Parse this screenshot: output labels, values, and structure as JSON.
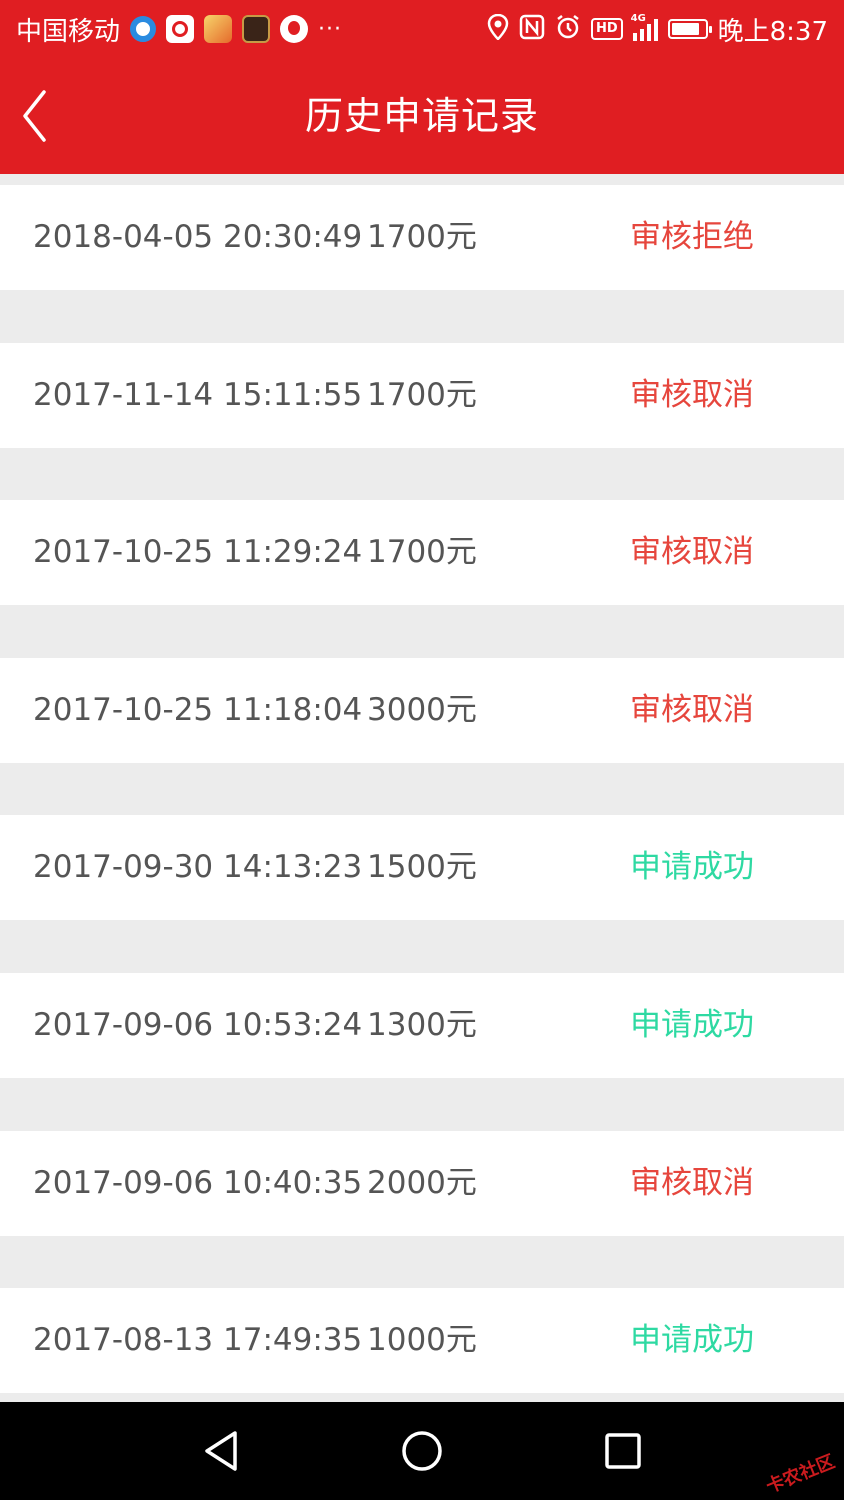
{
  "status_bar": {
    "carrier": "中国移动",
    "more": "···",
    "network": "4G",
    "time": "晚上8:37",
    "icons": [
      "location-icon",
      "nfc-icon",
      "alarm-icon",
      "hd-icon",
      "signal-icon",
      "battery-icon"
    ],
    "battery_level": 0.85
  },
  "header": {
    "title": "历史申请记录",
    "back_icon": "chevron-left-icon"
  },
  "records": [
    {
      "datetime": "2018-04-05 20:30:49",
      "amount": "1700元",
      "status": "审核拒绝",
      "status_type": "rejected"
    },
    {
      "datetime": "2017-11-14 15:11:55",
      "amount": "1700元",
      "status": "审核取消",
      "status_type": "cancelled"
    },
    {
      "datetime": "2017-10-25 11:29:24",
      "amount": "1700元",
      "status": "审核取消",
      "status_type": "cancelled"
    },
    {
      "datetime": "2017-10-25 11:18:04",
      "amount": "3000元",
      "status": "审核取消",
      "status_type": "cancelled"
    },
    {
      "datetime": "2017-09-30 14:13:23",
      "amount": "1500元",
      "status": "申请成功",
      "status_type": "success"
    },
    {
      "datetime": "2017-09-06 10:53:24",
      "amount": "1300元",
      "status": "申请成功",
      "status_type": "success"
    },
    {
      "datetime": "2017-09-06 10:40:35",
      "amount": "2000元",
      "status": "审核取消",
      "status_type": "cancelled"
    },
    {
      "datetime": "2017-08-13 17:49:35",
      "amount": "1000元",
      "status": "申请成功",
      "status_type": "success"
    }
  ],
  "colors": {
    "brand_red": "#e01e22",
    "status_red": "#e6463d",
    "status_green": "#2ed9a2",
    "separator": "#ececec"
  },
  "nav": {
    "icons": [
      "back-triangle-icon",
      "home-circle-icon",
      "recents-square-icon"
    ]
  },
  "watermark": "卡农社区"
}
